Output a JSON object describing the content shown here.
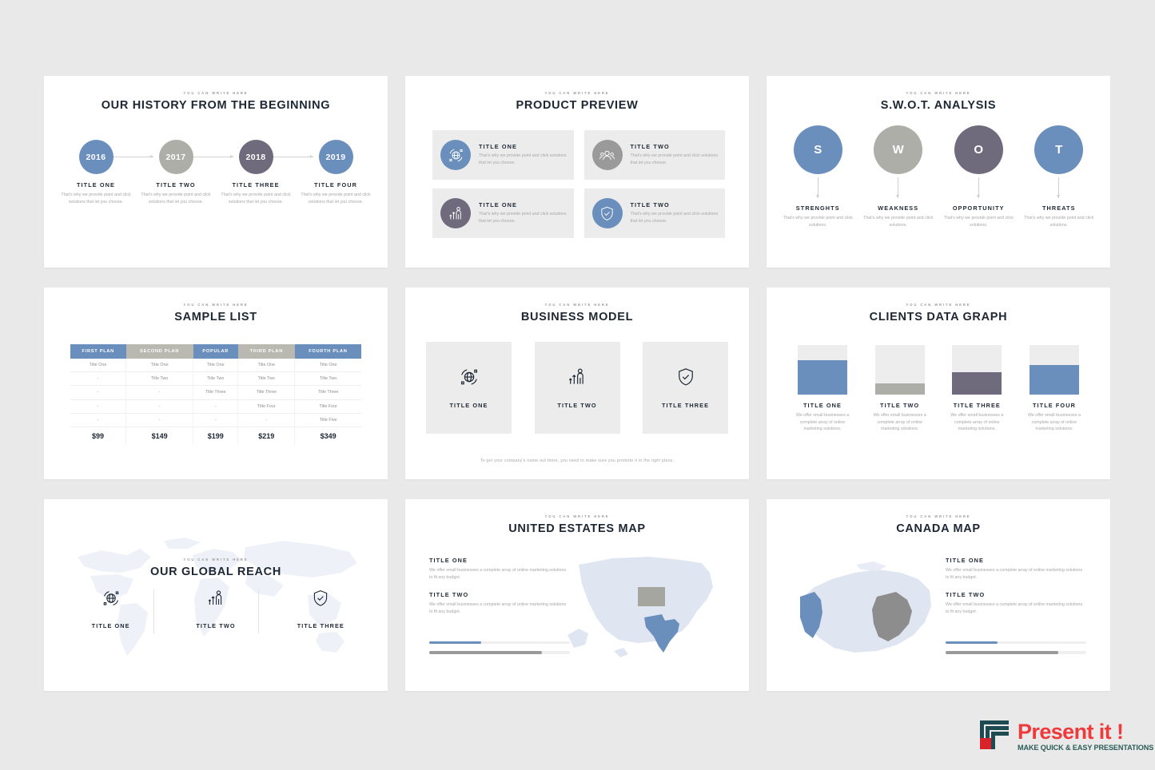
{
  "palette": {
    "page_bg": "#eae9e9",
    "slide_bg": "#ffffff",
    "blue": "#6b8fbc",
    "sage": "#adaea7",
    "plum": "#6f6b7d",
    "dark": "#1d2733",
    "muted": "#a7a7a7",
    "panel": "#ececec",
    "logo_red": "#ee3a3a",
    "logo_teal": "#2a5c57"
  },
  "eyebrow": "YOU CAN WRITE HERE",
  "slides": {
    "history": {
      "title": "OUR HISTORY FROM THE BEGINNING",
      "items": [
        {
          "year": "2016",
          "label": "TITLE ONE",
          "body": "That's why we provide point and click solutions that let you choose.",
          "color": "#6b8fbc"
        },
        {
          "year": "2017",
          "label": "TITLE TWO",
          "body": "That's why we provide point and click solutions that let you choose.",
          "color": "#adaea7"
        },
        {
          "year": "2018",
          "label": "TITLE THREE",
          "body": "That's why we provide point and click solutions that let you choose.",
          "color": "#6f6b7d"
        },
        {
          "year": "2019",
          "label": "TITLE FOUR",
          "body": "That's why we provide point and click solutions that let you choose.",
          "color": "#6b8fbc"
        }
      ]
    },
    "product_preview": {
      "title": "PRODUCT PREVIEW",
      "cards": [
        {
          "label": "TITLE ONE",
          "body": "That's why we provide point and click solutions that let you choose.",
          "color": "#6b8fbc",
          "icon": "globe-network-icon"
        },
        {
          "label": "TITLE TWO",
          "body": "That's why we provide point and click solutions that let you choose.",
          "color": "#9a9a9a",
          "icon": "user-group-icon"
        },
        {
          "label": "TITLE ONE",
          "body": "That's why we provide point and click solutions that let you choose.",
          "color": "#6f6b7d",
          "icon": "growth-person-icon"
        },
        {
          "label": "TITLE TWO",
          "body": "That's why we provide point and click solutions that let you choose.",
          "color": "#6b8fbc",
          "icon": "shield-check-icon"
        }
      ]
    },
    "swot": {
      "title": "S.W.O.T. ANALYSIS",
      "items": [
        {
          "letter": "S",
          "label": "STRENGHTS",
          "body": "That's why we provide point and click solutions.",
          "color": "#6b8fbc"
        },
        {
          "letter": "W",
          "label": "WEAKNESS",
          "body": "That's why we provide point and click solutions.",
          "color": "#adaea7"
        },
        {
          "letter": "O",
          "label": "OPPORTUNITY",
          "body": "That's why we provide point and click solutions.",
          "color": "#6f6b7d"
        },
        {
          "letter": "T",
          "label": "THREATS",
          "body": "That's why we provide point and click solutions.",
          "color": "#6b8fbc"
        }
      ]
    },
    "sample_list": {
      "title": "SAMPLE LIST",
      "columns": [
        {
          "label": "FIRST PLAN",
          "color": "#6b8fbc"
        },
        {
          "label": "SECOND PLAN",
          "color": "#b9b9b2"
        },
        {
          "label": "POPULAR",
          "color": "#6b8fbc"
        },
        {
          "label": "THIRD PLAN",
          "color": "#b9b9b2"
        },
        {
          "label": "FOURTH PLAN",
          "color": "#6b8fbc"
        }
      ],
      "rows": [
        [
          "Title One",
          "Title One",
          "Title One",
          "Title One",
          "Title One"
        ],
        [
          "-",
          "Title Two",
          "Title Two",
          "Title Two",
          "Title Two"
        ],
        [
          "-",
          "-",
          "Title Three",
          "Title Three",
          "Title Three"
        ],
        [
          "-",
          "-",
          "-",
          "Title Four",
          "Title Four"
        ],
        [
          "-",
          "-",
          "-",
          "-",
          "Title Five"
        ]
      ],
      "prices": [
        "$99",
        "$149",
        "$199",
        "$219",
        "$349"
      ]
    },
    "business_model": {
      "title": "BUSINESS MODEL",
      "cards": [
        {
          "label": "TITLE ONE",
          "icon": "globe-network-icon"
        },
        {
          "label": "TITLE TWO",
          "icon": "growth-person-icon"
        },
        {
          "label": "TITLE THREE",
          "icon": "shield-check-icon"
        }
      ],
      "footer": "To get your company's name out there, you need to make sure you promote it in the right place."
    },
    "clients_data_graph": {
      "title": "CLIENTS DATA GRAPH",
      "items": [
        {
          "label": "TITLE ONE",
          "body": "We offer small businesses a complete array of online marketing solutions.",
          "value": 70,
          "color": "#6b8fbc"
        },
        {
          "label": "TITLE TWO",
          "body": "We offer small businesses a complete array of online marketing solutions.",
          "value": 22,
          "color": "#adaea7"
        },
        {
          "label": "TITLE THREE",
          "body": "We offer small businesses a complete array of online marketing solutions.",
          "value": 45,
          "color": "#6f6b7d"
        },
        {
          "label": "TITLE FOUR",
          "body": "We offer small businesses a complete array of online marketing solutions.",
          "value": 60,
          "color": "#6b8fbc"
        }
      ]
    },
    "global_reach": {
      "title": "OUR GLOBAL REACH",
      "items": [
        {
          "label": "TITLE ONE",
          "icon": "globe-network-icon"
        },
        {
          "label": "TITLE TWO",
          "icon": "growth-person-icon"
        },
        {
          "label": "TITLE THREE",
          "icon": "shield-check-icon"
        }
      ]
    },
    "us_map": {
      "title": "UNITED ESTATES MAP",
      "blocks": [
        {
          "label": "TITLE ONE",
          "body": "We offer small businesses a complete array of online marketing solutions to fit any budget."
        },
        {
          "label": "TITLE TWO",
          "body": "We offer small businesses a complete array of online marketing solutions to fit any budget."
        }
      ],
      "bars": [
        {
          "value": 37,
          "color": "#6b8fbc"
        },
        {
          "value": 80,
          "color": "#9a9a9a"
        }
      ],
      "highlights": [
        {
          "name": "wyoming",
          "color": "#a5a69f"
        },
        {
          "name": "texas",
          "color": "#6b8fbc"
        }
      ]
    },
    "canada_map": {
      "title": "CANADA MAP",
      "blocks": [
        {
          "label": "TITLE ONE",
          "body": "We offer small businesses a complete array of online marketing solutions to fit any budget."
        },
        {
          "label": "TITLE TWO",
          "body": "We offer small businesses a complete array of online marketing solutions to fit any budget."
        }
      ],
      "bars": [
        {
          "value": 37,
          "color": "#6b8fbc"
        },
        {
          "value": 80,
          "color": "#9a9a9a"
        }
      ],
      "highlights": [
        {
          "name": "british-columbia",
          "color": "#6b8fbc"
        },
        {
          "name": "quebec",
          "color": "#8d8d8d"
        }
      ]
    }
  },
  "logo": {
    "main": "Present it !",
    "tagline": "MAKE QUICK & EASY PRESENTATIONS"
  },
  "chart_data": {
    "type": "bar",
    "title": "CLIENTS DATA GRAPH",
    "categories": [
      "TITLE ONE",
      "TITLE TWO",
      "TITLE THREE",
      "TITLE FOUR"
    ],
    "values": [
      70,
      22,
      45,
      60
    ],
    "ylim": [
      0,
      100
    ],
    "ylabel": "",
    "xlabel": "",
    "grid": false,
    "legend": "none"
  }
}
